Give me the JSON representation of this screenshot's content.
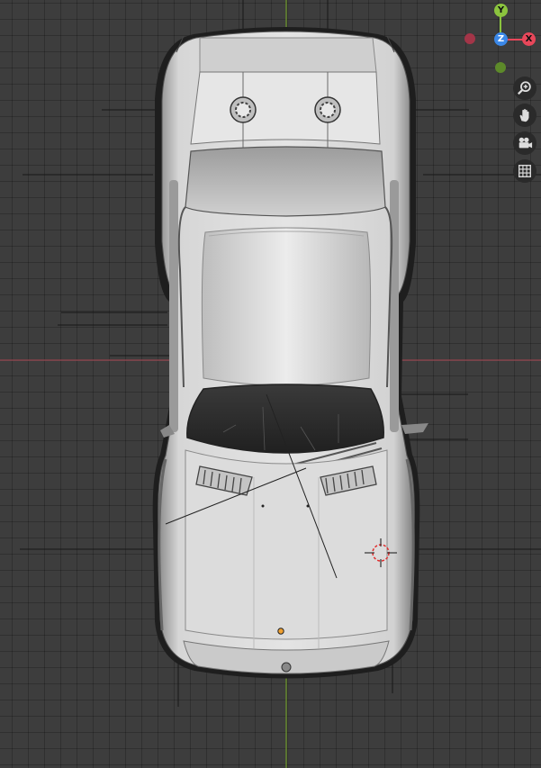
{
  "viewport": {
    "mode": "top-orthographic",
    "background": "#3d3d3d",
    "grid_color": "#333333",
    "x_axis_color": "#9a4a53",
    "y_axis_color": "#6f9a2a"
  },
  "gizmo": {
    "y_label": "Y",
    "z_label": "Z",
    "x_label": "X",
    "y_color": "#8bc43e",
    "x_color": "#e8475a",
    "z_color": "#3b88e8",
    "neg_x_color": "#a33548",
    "neg_y_color": "#5d8a2a"
  },
  "navigation": {
    "zoom": "zoom-icon",
    "pan": "hand-icon",
    "camera": "camera-icon",
    "ortho": "grid-icon"
  },
  "scene": {
    "object": "car-model-top-view",
    "body_color": "#d8d8d8",
    "shadow_color": "#1e1e1e",
    "origin_color": "#f0a030",
    "cursor": "3d-cursor"
  }
}
